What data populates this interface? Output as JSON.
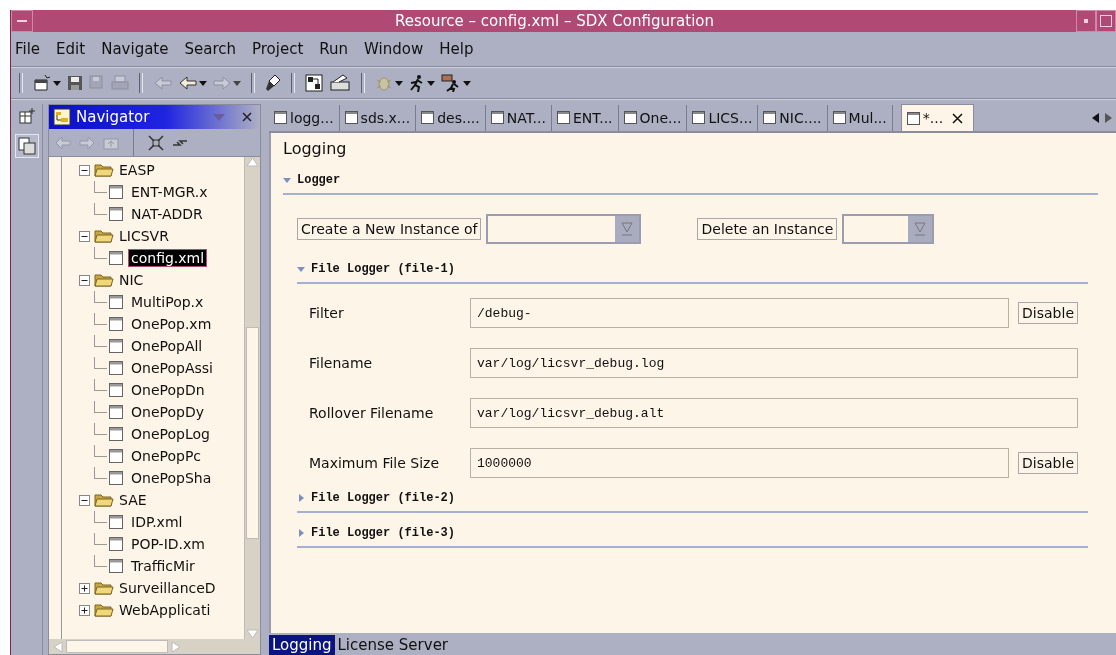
{
  "window": {
    "title": "Resource – config.xml – SDX Configuration"
  },
  "menu": [
    "File",
    "Edit",
    "Navigate",
    "Search",
    "Project",
    "Run",
    "Window",
    "Help"
  ],
  "navigator": {
    "title": "Navigator",
    "tree": [
      {
        "label": "EASP",
        "expanded": true,
        "selected": false,
        "children": [
          {
            "label": "ENT-MGR.x",
            "selected": false
          },
          {
            "label": "NAT-ADDR",
            "selected": false
          }
        ]
      },
      {
        "label": "LICSVR",
        "expanded": true,
        "selected": false,
        "children": [
          {
            "label": "config.xml",
            "selected": true
          }
        ]
      },
      {
        "label": "NIC",
        "expanded": true,
        "selected": false,
        "children": [
          {
            "label": "MultiPop.x",
            "selected": false
          },
          {
            "label": "OnePop.xm",
            "selected": false
          },
          {
            "label": "OnePopAll",
            "selected": false
          },
          {
            "label": "OnePopAssi",
            "selected": false
          },
          {
            "label": "OnePopDn",
            "selected": false
          },
          {
            "label": "OnePopDy",
            "selected": false
          },
          {
            "label": "OnePopLog",
            "selected": false
          },
          {
            "label": "OnePopPc",
            "selected": false
          },
          {
            "label": "OnePopSha",
            "selected": false
          }
        ]
      },
      {
        "label": "SAE",
        "expanded": true,
        "selected": false,
        "children": [
          {
            "label": "IDP.xml",
            "selected": false
          },
          {
            "label": "POP-ID.xm",
            "selected": false
          },
          {
            "label": "TrafficMir",
            "selected": false
          }
        ]
      },
      {
        "label": "SurveillanceD",
        "expanded": false,
        "selected": false
      },
      {
        "label": "WebApplicati",
        "expanded": false,
        "selected": false
      }
    ]
  },
  "editor_tabs": [
    {
      "label": "logg...",
      "selected": false
    },
    {
      "label": "sds.x...",
      "selected": false
    },
    {
      "label": "des....",
      "selected": false
    },
    {
      "label": "NAT...",
      "selected": false
    },
    {
      "label": "ENT...",
      "selected": false
    },
    {
      "label": "One...",
      "selected": false
    },
    {
      "label": "LICS...",
      "selected": false
    },
    {
      "label": "NIC....",
      "selected": false
    },
    {
      "label": "Mul...",
      "selected": false
    },
    {
      "label": "*...",
      "selected": true
    }
  ],
  "form": {
    "title": "Logging",
    "logger": {
      "title": "Logger",
      "expanded": true,
      "create_button": "Create a New Instance of",
      "delete_button": "Delete an Instance"
    },
    "file_loggers": [
      {
        "title": "File Logger (file-1)",
        "expanded": true,
        "fields": [
          {
            "label": "Filter",
            "value": "/debug-",
            "button": "Disable"
          },
          {
            "label": "Filename",
            "value": "var/log/licsvr_debug.log"
          },
          {
            "label": "Rollover Filename",
            "value": "var/log/licsvr_debug.alt"
          },
          {
            "label": "Maximum File Size",
            "value": "1000000",
            "button": "Disable"
          }
        ]
      },
      {
        "title": "File Logger (file-2)",
        "expanded": false
      },
      {
        "title": "File Logger (file-3)",
        "expanded": false
      }
    ]
  },
  "bottom_tabs": [
    {
      "label": "Logging",
      "selected": true
    },
    {
      "label": "License Server",
      "selected": false
    }
  ]
}
